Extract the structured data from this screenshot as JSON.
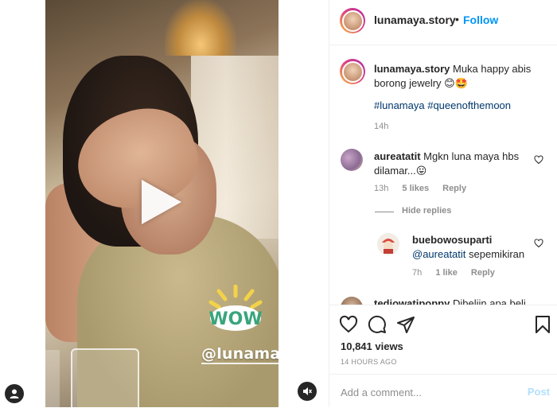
{
  "video": {
    "sticker_text": "WOW",
    "overlay_handle": "@lunamaya"
  },
  "header": {
    "username": "lunamaya.story",
    "separator": "•",
    "follow_label": "Follow"
  },
  "caption": {
    "username": "lunamaya.story",
    "text": "Muka happy abis borong jewelry",
    "emojis": "😊🤩",
    "hashtags": "#lunamaya #queenofthemoon",
    "time": "14h"
  },
  "comments": [
    {
      "username": "aureatatit",
      "text": "Mgkn luna maya hbs dilamar...",
      "emoji": "😛",
      "time": "13h",
      "likes": "5 likes",
      "reply_label": "Reply"
    }
  ],
  "hide_replies_label": "Hide replies",
  "replies": [
    {
      "username": "buebowosuparti",
      "mention": "@aureatatit",
      "text": "sepemikiran",
      "time": "7h",
      "likes": "1 like",
      "reply_label": "Reply"
    }
  ],
  "partial_comment": {
    "username": "tedjowatipoppy",
    "text": "Dibeliin apa beli"
  },
  "stats": {
    "views": "10,841 views",
    "posted_ago": "14 HOURS AGO"
  },
  "comment_box": {
    "placeholder": "Add a comment...",
    "post_label": "Post"
  },
  "colors": {
    "accent": "#0095f6",
    "link": "#00376b",
    "muted": "#8e8e8e",
    "post_disabled": "#b2dffc"
  }
}
